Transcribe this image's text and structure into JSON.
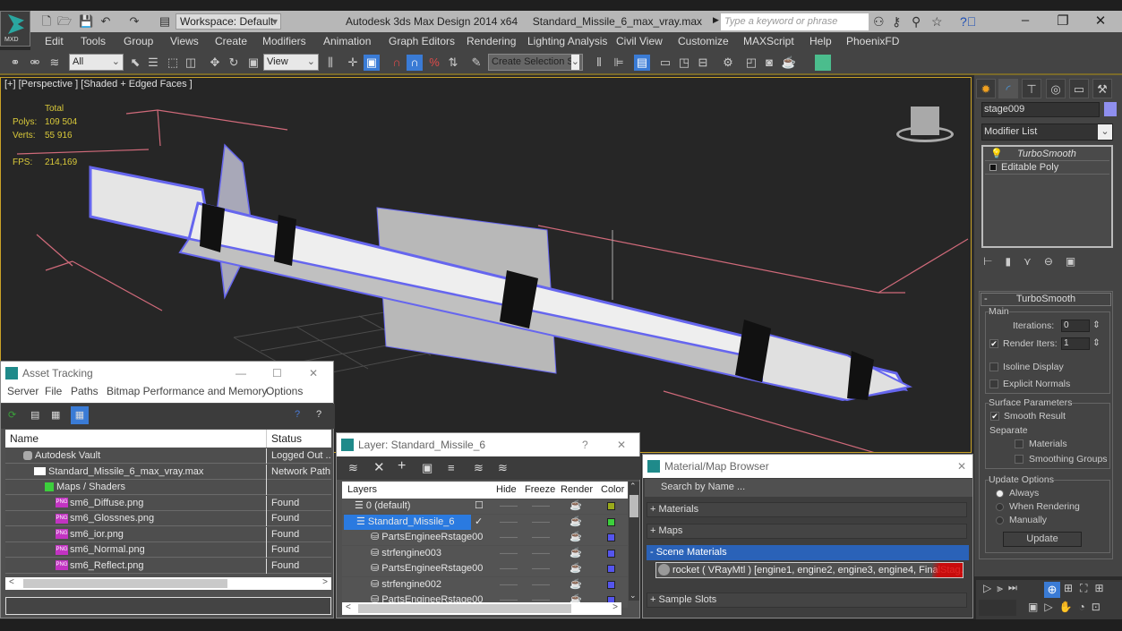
{
  "app": {
    "title": "Autodesk 3ds Max Design 2014 x64",
    "file": "Standard_Missile_6_max_vray.max",
    "logo_text": "MXD",
    "workspace": "Workspace: Default",
    "search_placeholder": "Type a keyword or phrase"
  },
  "menu": [
    "Edit",
    "Tools",
    "Group",
    "Views",
    "Create",
    "Modifiers",
    "Animation",
    "Graph Editors",
    "Rendering",
    "Lighting Analysis",
    "Civil View",
    "Customize",
    "MAXScript",
    "Help",
    "PhoenixFD"
  ],
  "toolbar": {
    "selection_filter": "All",
    "ref_coord": "View",
    "named_selection": "Create Selection Se"
  },
  "viewport": {
    "label": "[+] [Perspective ] [Shaded + Edged Faces ]",
    "stats_header": "Total",
    "polys_label": "Polys:",
    "polys": "109 504",
    "verts_label": "Verts:",
    "verts": "55 916",
    "fps_label": "FPS:",
    "fps": "214,169"
  },
  "command_panel": {
    "object_name": "stage009",
    "object_color": "#8f8fef",
    "modifier_list": "Modifier List",
    "stack": [
      "TurboSmooth",
      "Editable Poly"
    ],
    "rollout_title": "TurboSmooth",
    "main_group": "Main",
    "iterations_label": "Iterations:",
    "iterations": "0",
    "render_iters_label": "Render Iters:",
    "render_iters": "1",
    "render_iters_checked": true,
    "isoline_display": "Isoline Display",
    "explicit_normals": "Explicit Normals",
    "surface_params": "Surface Parameters",
    "smooth_result": "Smooth Result",
    "separate": "Separate",
    "materials": "Materials",
    "smoothing_groups": "Smoothing Groups",
    "update_options": "Update Options",
    "always": "Always",
    "when_rendering": "When Rendering",
    "manually": "Manually",
    "update_button": "Update"
  },
  "asset_tracking": {
    "title": "Asset Tracking",
    "menu": [
      "Server",
      "File",
      "Paths",
      "Bitmap Performance and Memory",
      "Options"
    ],
    "col_name": "Name",
    "col_status": "Status",
    "rows": [
      {
        "name": "Autodesk Vault",
        "status": "Logged Out ..",
        "indent": 1
      },
      {
        "name": "Standard_Missile_6_max_vray.max",
        "status": "Network Path",
        "indent": 2
      },
      {
        "name": "Maps / Shaders",
        "status": "",
        "indent": 3
      },
      {
        "name": "sm6_Diffuse.png",
        "status": "Found",
        "indent": 4
      },
      {
        "name": "sm6_Glossnes.png",
        "status": "Found",
        "indent": 4
      },
      {
        "name": "sm6_ior.png",
        "status": "Found",
        "indent": 4
      },
      {
        "name": "sm6_Normal.png",
        "status": "Found",
        "indent": 4
      },
      {
        "name": "sm6_Reflect.png",
        "status": "Found",
        "indent": 4
      }
    ]
  },
  "layer_dialog": {
    "title": "Layer: Standard_Missile_6",
    "help": "?",
    "cols": [
      "Layers",
      "Hide",
      "Freeze",
      "Render",
      "Color"
    ],
    "rows": [
      {
        "name": "0 (default)",
        "color": "#9aaa1a",
        "selected": false
      },
      {
        "name": "Standard_Missile_6",
        "color": "#3ccf3c",
        "selected": true
      },
      {
        "name": "PartsEngineeRstage00",
        "color": "#5555ee",
        "selected": false
      },
      {
        "name": "strfengine003",
        "color": "#5555ee",
        "selected": false
      },
      {
        "name": "PartsEngineeRstage00",
        "color": "#5555ee",
        "selected": false
      },
      {
        "name": "strfengine002",
        "color": "#5555ee",
        "selected": false
      },
      {
        "name": "PartsEngineeRstage00",
        "color": "#5555ee",
        "selected": false
      }
    ]
  },
  "material_browser": {
    "title": "Material/Map Browser",
    "search_placeholder": "Search by Name ...",
    "groups": [
      "+ Materials",
      "+ Maps",
      "- Scene Materials",
      "+ Sample Slots"
    ],
    "scene_material": "rocket  ( VRayMtl ) [engine1, engine2, engine3, engine4, FinalStag..."
  }
}
